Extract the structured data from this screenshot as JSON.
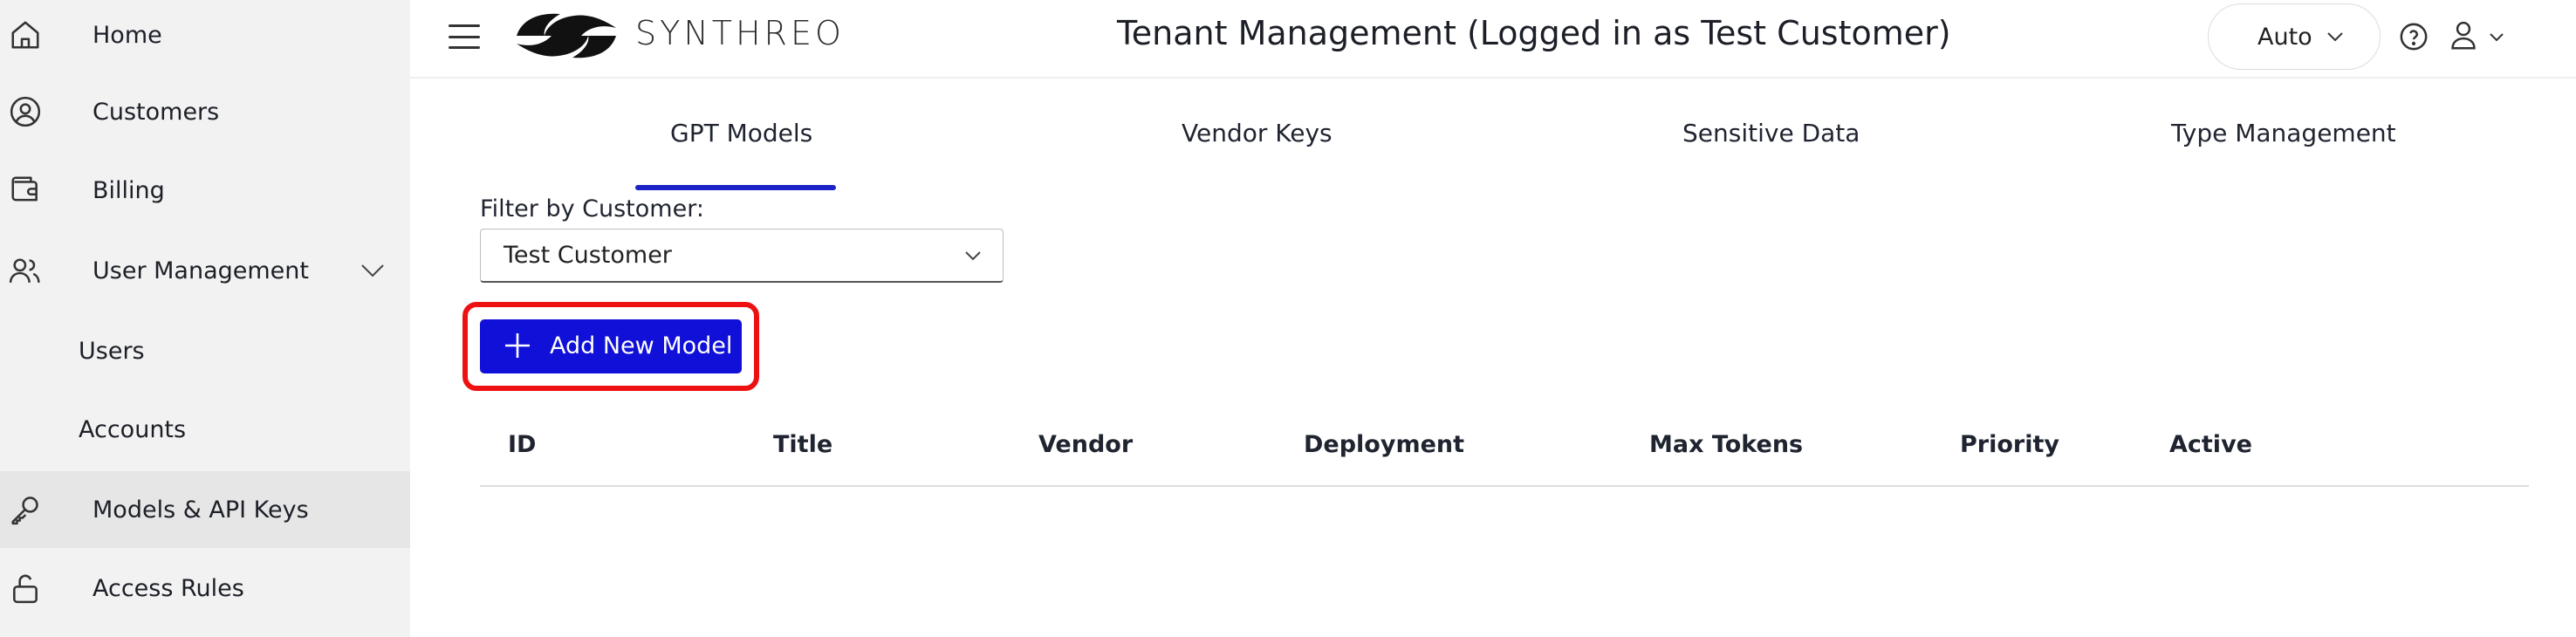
{
  "sidebar": {
    "items": [
      {
        "label": "Home",
        "icon": "home-icon"
      },
      {
        "label": "Customers",
        "icon": "user-circle-icon"
      },
      {
        "label": "Billing",
        "icon": "wallet-icon"
      },
      {
        "label": "User Management",
        "icon": "users-icon"
      },
      {
        "label": "Users"
      },
      {
        "label": "Accounts"
      },
      {
        "label": "Models & API Keys",
        "icon": "key-icon",
        "active": true
      },
      {
        "label": "Access Rules",
        "icon": "lock-icon"
      }
    ]
  },
  "header": {
    "brand": "SYNTHREO",
    "title": "Tenant Management (Logged in as Test Customer)",
    "theme_value": "Auto"
  },
  "tabs": [
    {
      "label": "GPT Models",
      "selected": true
    },
    {
      "label": "Vendor Keys"
    },
    {
      "label": "Sensitive Data"
    },
    {
      "label": "Type Management"
    }
  ],
  "filter": {
    "label": "Filter by Customer:",
    "value": "Test Customer"
  },
  "actions": {
    "add_model_label": "Add New Model"
  },
  "table": {
    "columns": [
      "ID",
      "Title",
      "Vendor",
      "Deployment",
      "Max Tokens",
      "Priority",
      "Active"
    ],
    "rows": []
  },
  "colors": {
    "accent": "#1010d8",
    "highlight": "#ee1111",
    "sidebar_bg": "#f2f2f2"
  }
}
